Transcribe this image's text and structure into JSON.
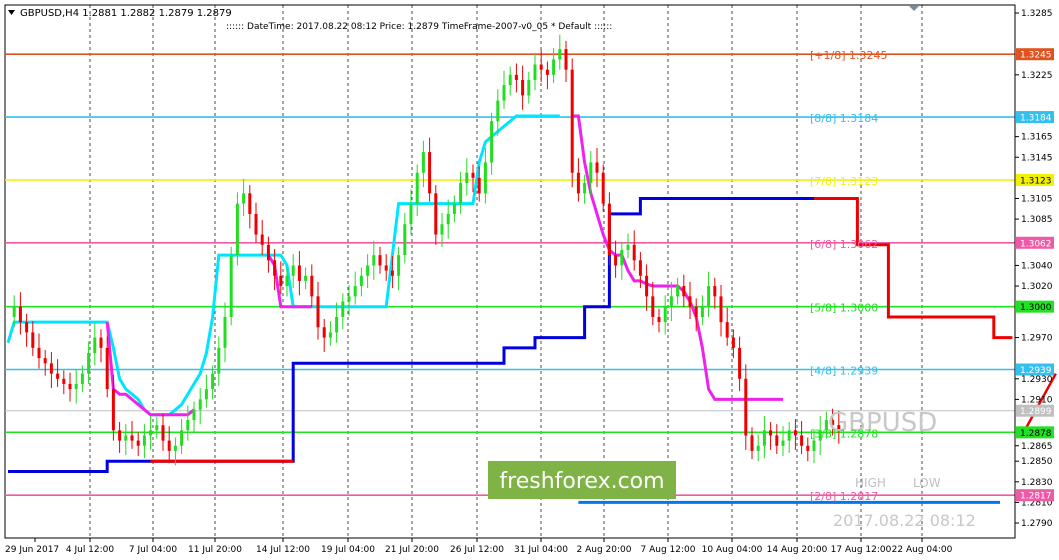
{
  "header": {
    "symbol_line": "GBPUSD,H4  1.2881 1.2882 1.2879 1.2879",
    "info_line": ":::::: DateTime: 2017.08.22 08:12    Price: 1.2879    TimeFrame-2007-v0_05    *   Default    ::::::"
  },
  "watermark": {
    "symbol": "GBPUSD",
    "datetime": "2017.08.22 08:12",
    "brand": "freshforex.com",
    "high_label": "HIGH",
    "low_label": "LOW"
  },
  "chart_data": {
    "type": "candlestick",
    "symbol": "GBPUSD",
    "timeframe": "H4",
    "ohlc_current": {
      "open": 1.2881,
      "high": 1.2882,
      "low": 1.2879,
      "close": 1.2879
    },
    "ylim": [
      1.2791,
      1.3285
    ],
    "yticks": [
      "1.3285",
      "1.3245",
      "1.3225",
      "1.3184",
      "1.3165",
      "1.3145",
      "1.3123",
      "1.3105",
      "1.3085",
      "1.3062",
      "1.3040",
      "1.3020",
      "1.3000",
      "1.2970",
      "1.2939",
      "1.2930",
      "1.2910",
      "1.2899",
      "1.2878",
      "1.2865",
      "1.2850",
      "1.2830",
      "1.2817",
      "1.2810",
      "1.2790"
    ],
    "xticks": [
      "29 Jun 2017",
      "4 Jul 12:00",
      "7 Jul 04:00",
      "11 Jul 20:00",
      "14 Jul 12:00",
      "19 Jul 04:00",
      "21 Jul 20:00",
      "26 Jul 12:00",
      "31 Jul 04:00",
      "2 Aug 20:00",
      "7 Aug 12:00",
      "10 Aug 04:00",
      "14 Aug 20:00",
      "17 Aug 12:00",
      "22 Aug 04:00"
    ],
    "murrey_levels": [
      {
        "label": "[+1/8]",
        "value": 1.3245,
        "color": "#e0531e"
      },
      {
        "label": "[8/8]",
        "value": 1.3184,
        "color": "#33c0ee"
      },
      {
        "label": "[7/8]",
        "value": 1.3123,
        "color": "#f2f200"
      },
      {
        "label": "[6/8]",
        "value": 1.3062,
        "color": "#ee5aa6"
      },
      {
        "label": "[5/8]",
        "value": 1.3,
        "color": "#22e022"
      },
      {
        "label": "[4/8]",
        "value": 1.2939,
        "color": "#33c0ee"
      },
      {
        "label": "[3/8]",
        "value": 1.2878,
        "color": "#22e022"
      },
      {
        "label": "[2/8]",
        "value": 1.2817,
        "color": "#ee5aa6"
      }
    ],
    "current_price": 1.2899,
    "price_series": [
      1.299,
      1.3,
      1.2985,
      1.2975,
      1.296,
      1.295,
      1.2945,
      1.2935,
      1.293,
      1.2925,
      1.292,
      1.2925,
      1.2935,
      1.2955,
      1.297,
      1.296,
      1.292,
      1.288,
      1.287,
      1.2875,
      1.287,
      1.2865,
      1.2875,
      1.288,
      1.2885,
      1.287,
      1.286,
      1.2865,
      1.288,
      1.289,
      1.29,
      1.291,
      1.292,
      1.2935,
      1.296,
      1.299,
      1.305,
      1.31,
      1.311,
      1.309,
      1.307,
      1.306,
      1.3045,
      1.303,
      1.302,
      1.303,
      1.304,
      1.3025,
      1.303,
      1.301,
      1.298,
      1.297,
      1.2975,
      1.299,
      1.3005,
      1.301,
      1.302,
      1.303,
      1.304,
      1.305,
      1.304,
      1.3035,
      1.303,
      1.305,
      1.308,
      1.31,
      1.313,
      1.315,
      1.311,
      1.307,
      1.308,
      1.309,
      1.31,
      1.312,
      1.313,
      1.3125,
      1.311,
      1.314,
      1.318,
      1.32,
      1.3215,
      1.3225,
      1.322,
      1.3205,
      1.322,
      1.3235,
      1.323,
      1.3225,
      1.324,
      1.325,
      1.323,
      1.313,
      1.311,
      1.312,
      1.314,
      1.313,
      1.31,
      1.305,
      1.304,
      1.3055,
      1.306,
      1.3045,
      1.303,
      1.301,
      1.299,
      1.2985,
      1.3,
      1.301,
      1.302,
      1.301,
      1.3,
      1.299,
      1.3,
      1.302,
      1.301,
      1.2985,
      1.297,
      1.296,
      1.293,
      1.2875,
      1.286,
      1.2865,
      1.288,
      1.2875,
      1.2865,
      1.287,
      1.288,
      1.2875,
      1.2865,
      1.286,
      1.287,
      1.288,
      1.289,
      1.2885,
      1.2879
    ],
    "overlays": [
      {
        "name": "",
        "color": "#00e5ff",
        "values": [
          1.2965,
          1.2985,
          1.2985,
          1.2985,
          1.2985,
          1.2985,
          1.2985,
          1.2985,
          1.2985,
          1.2985,
          1.2985,
          1.2985,
          1.2985,
          1.2985,
          1.2985,
          1.2985,
          1.2985,
          1.296,
          1.293,
          1.292,
          1.2915,
          1.291,
          1.29,
          1.2895,
          1.2895,
          1.2895,
          1.2895,
          1.29,
          1.2905,
          1.2915,
          1.2925,
          1.2935,
          1.2955,
          1.299,
          1.305,
          1.305,
          1.305,
          1.305,
          1.305,
          1.305,
          1.305,
          1.305,
          1.305,
          1.305,
          1.305,
          1.304,
          1.3,
          1.3,
          1.3,
          1.3,
          1.3,
          1.3,
          1.3,
          1.3,
          1.3,
          1.3,
          1.3,
          1.3,
          1.3,
          1.3,
          1.3,
          1.3,
          1.305,
          1.31,
          1.31,
          1.31,
          1.31,
          1.31,
          1.31,
          1.31,
          1.31,
          1.31,
          1.31,
          1.31,
          1.31,
          1.31,
          1.314,
          1.316,
          1.3165,
          1.317,
          1.3175,
          1.318,
          1.3185,
          1.3185,
          1.3185,
          1.3185,
          1.3185,
          1.3185,
          1.3185,
          1.3185
        ]
      },
      {
        "name": "",
        "color": "#ee22ee",
        "values": [
          null,
          null,
          null,
          null,
          null,
          null,
          null,
          null,
          null,
          null,
          null,
          null,
          null,
          null,
          null,
          null,
          1.2985,
          1.292,
          1.2915,
          1.2915,
          1.291,
          1.2905,
          1.29,
          1.2895,
          1.2895,
          1.2895,
          1.2895,
          1.2895,
          1.2895,
          1.2895,
          1.29,
          null,
          null,
          null,
          null,
          null,
          null,
          null,
          null,
          null,
          null,
          null,
          1.305,
          1.304,
          1.3,
          1.3,
          1.3,
          1.3,
          1.3,
          1.3,
          null,
          null,
          null,
          null,
          null,
          null,
          null,
          null,
          null,
          null,
          null,
          null,
          null,
          null,
          null,
          null,
          null,
          null,
          null,
          null,
          null,
          null,
          null,
          null,
          null,
          null,
          null,
          null,
          null,
          null,
          null,
          null,
          null,
          null,
          null,
          null,
          null,
          null,
          null,
          null,
          null,
          1.3185,
          1.3185,
          1.314,
          1.311,
          1.309,
          1.307,
          1.3055,
          1.305,
          1.305,
          1.3035,
          1.3025,
          1.3025,
          1.3022,
          1.302,
          1.302,
          1.302,
          1.302,
          1.302,
          1.3015,
          1.3005,
          1.299,
          1.296,
          1.292,
          1.291,
          1.291,
          1.291,
          1.291,
          1.291,
          1.291,
          1.291,
          1.291,
          1.291,
          1.291,
          1.291,
          1.291
        ]
      }
    ],
    "support_lines": [
      {
        "name": "",
        "color": "#0000dd",
        "points": [
          [
            0,
            1.284
          ],
          [
            16,
            1.284
          ],
          [
            16,
            1.285
          ],
          [
            46,
            1.285
          ],
          [
            46,
            1.2945
          ],
          [
            80,
            1.2945
          ],
          [
            80,
            1.296
          ],
          [
            85,
            1.296
          ],
          [
            85,
            1.297
          ],
          [
            93,
            1.297
          ],
          [
            93,
            1.3
          ],
          [
            97,
            1.3
          ],
          [
            97,
            1.309
          ],
          [
            102,
            1.309
          ],
          [
            102,
            1.3105
          ],
          [
            130,
            1.3105
          ]
        ]
      },
      {
        "name": "",
        "color": "#ee0000",
        "points": [
          [
            23,
            1.285
          ],
          [
            46,
            1.285
          ],
          [
            null,
            null
          ],
          [
            130,
            1.3105
          ],
          [
            137,
            1.3105
          ],
          [
            137,
            1.306
          ],
          [
            142,
            1.306
          ],
          [
            142,
            1.299
          ],
          [
            159,
            1.299
          ],
          [
            159,
            1.297
          ],
          [
            162,
            1.297
          ]
        ]
      },
      {
        "name": "",
        "color": "#0077ee",
        "points": [
          [
            92,
            1.281
          ],
          [
            160,
            1.281
          ]
        ]
      }
    ],
    "arrow": {
      "from": [
        164,
        1.288
      ],
      "to": [
        169,
        1.2935
      ],
      "color": "#ee0000"
    },
    "bull_color": "#22dd22",
    "bear_color": "#ee0000",
    "grid": "vertical dashed"
  }
}
